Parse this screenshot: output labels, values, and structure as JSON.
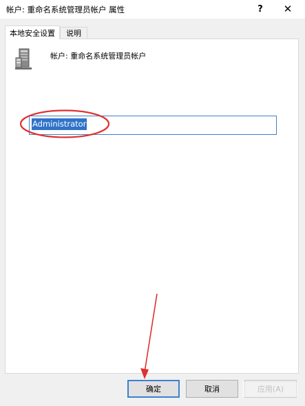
{
  "window": {
    "title": "帐户: 重命名系统管理员帐户 属性",
    "help_label": "?",
    "close_label": "✕"
  },
  "tabs": [
    {
      "label": "本地安全设置",
      "active": true
    },
    {
      "label": "说明",
      "active": false
    }
  ],
  "panel": {
    "heading": "帐户: 重命名系统管理员帐户",
    "icon": "server-icon",
    "account_name_value": "Administrator"
  },
  "buttons": {
    "ok": "确定",
    "cancel": "取消",
    "apply": "应用(A)"
  },
  "colors": {
    "selection": "#2f73c9",
    "annotation": "#e03030",
    "focus_border": "#3c7fd0"
  }
}
